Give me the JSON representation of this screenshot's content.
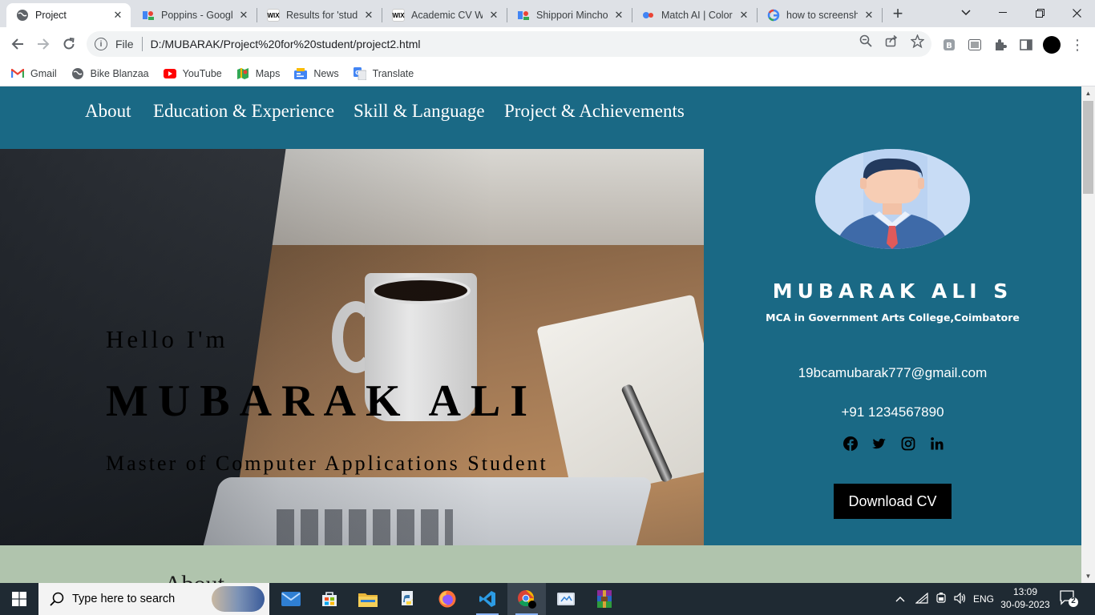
{
  "browser": {
    "tabs": [
      {
        "title": "Project",
        "icon": "globe-icon"
      },
      {
        "title": "Poppins - Googl",
        "icon": "google-fonts-icon"
      },
      {
        "title": "Results for 'stude",
        "icon": "wix-icon"
      },
      {
        "title": "Academic CV We",
        "icon": "wix-icon"
      },
      {
        "title": "Shippori Mincho",
        "icon": "google-fonts-icon"
      },
      {
        "title": "Match AI | Color",
        "icon": "match-ai-icon"
      },
      {
        "title": "how to screensh",
        "icon": "google-icon"
      }
    ],
    "url_scheme": "File",
    "url": "D:/MUBARAK/Project%20for%20student/project2.html",
    "bookmarks": [
      {
        "label": "Gmail",
        "icon": "gmail-icon"
      },
      {
        "label": "Bike Blanzaa",
        "icon": "globe-icon"
      },
      {
        "label": "YouTube",
        "icon": "youtube-icon"
      },
      {
        "label": "Maps",
        "icon": "maps-icon"
      },
      {
        "label": "News",
        "icon": "news-icon"
      },
      {
        "label": "Translate",
        "icon": "translate-icon"
      }
    ]
  },
  "site": {
    "nav": [
      "About",
      "Education & Experience",
      "Skill & Language",
      "Project & Achievements"
    ],
    "hero": {
      "greeting": "Hello I'm",
      "name": "MUBARAK ALI",
      "role": "Master of Computer Applications Student"
    },
    "profile": {
      "name": "MUBARAK ALI S",
      "degree": "MCA in Government Arts College,Coimbatore",
      "email": "19bcamubarak777@gmail.com",
      "phone": "+91 1234567890",
      "socials": [
        "facebook-icon",
        "twitter-icon",
        "instagram-icon",
        "linkedin-icon"
      ],
      "download_label": "Download CV"
    },
    "next_section_peek": "About"
  },
  "taskbar": {
    "search_placeholder": "Type here to search",
    "language": "ENG",
    "time": "13:09",
    "date": "30-09-2023",
    "notifications": "2"
  },
  "colors": {
    "theme_teal": "#1a6985",
    "about_band": "#b0c4ad",
    "button_black": "#000000"
  }
}
